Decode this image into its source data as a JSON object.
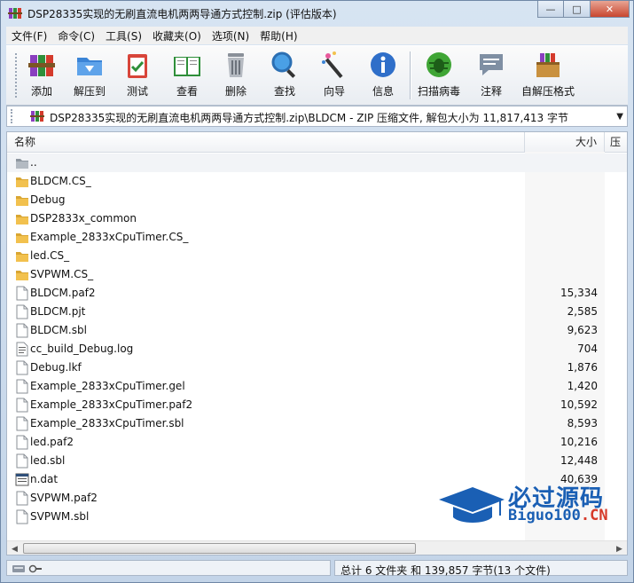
{
  "window": {
    "title": "DSP28335实现的无刷直流电机两两导通方式控制.zip (评估版本)",
    "controls": {
      "minimize": "—",
      "maximize": "□",
      "close": "✕"
    }
  },
  "menu": [
    "文件(F)",
    "命令(C)",
    "工具(S)",
    "收藏夹(O)",
    "选项(N)",
    "帮助(H)"
  ],
  "toolbar": {
    "buttons": [
      {
        "label": "添加",
        "icon": "books-icon"
      },
      {
        "label": "解压到",
        "icon": "folder-icon"
      },
      {
        "label": "测试",
        "icon": "clipboard-icon"
      },
      {
        "label": "查看",
        "icon": "book-icon"
      },
      {
        "label": "删除",
        "icon": "trash-icon"
      },
      {
        "label": "查找",
        "icon": "magnifier-icon"
      },
      {
        "label": "向导",
        "icon": "wand-icon"
      },
      {
        "label": "信息",
        "icon": "info-icon"
      },
      {
        "label": "扫描病毒",
        "icon": "bug-icon"
      },
      {
        "label": "注释",
        "icon": "comment-icon"
      },
      {
        "label": "自解压格式",
        "icon": "sfx-box-icon"
      }
    ]
  },
  "address": {
    "path": "DSP28335实现的无刷直流电机两两导通方式控制.zip\\BLDCM - ZIP 压缩文件, 解包大小为 11,817,413 字节"
  },
  "list": {
    "columns": {
      "name": "名称",
      "size": "大小",
      "packed": "压"
    },
    "rows": [
      {
        "name": "..",
        "size": "",
        "type": "parent"
      },
      {
        "name": "BLDCM.CS_",
        "size": "",
        "type": "folder"
      },
      {
        "name": "Debug",
        "size": "",
        "type": "folder"
      },
      {
        "name": "DSP2833x_common",
        "size": "",
        "type": "folder"
      },
      {
        "name": "Example_2833xCpuTimer.CS_",
        "size": "",
        "type": "folder"
      },
      {
        "name": "led.CS_",
        "size": "",
        "type": "folder"
      },
      {
        "name": "SVPWM.CS_",
        "size": "",
        "type": "folder"
      },
      {
        "name": "BLDCM.paf2",
        "size": "15,334",
        "type": "file"
      },
      {
        "name": "BLDCM.pjt",
        "size": "2,585",
        "type": "file"
      },
      {
        "name": "BLDCM.sbl",
        "size": "9,623",
        "type": "file"
      },
      {
        "name": "cc_build_Debug.log",
        "size": "704",
        "type": "log"
      },
      {
        "name": "Debug.lkf",
        "size": "1,876",
        "type": "file"
      },
      {
        "name": "Example_2833xCpuTimer.gel",
        "size": "1,420",
        "type": "file"
      },
      {
        "name": "Example_2833xCpuTimer.paf2",
        "size": "10,592",
        "type": "file"
      },
      {
        "name": "Example_2833xCpuTimer.sbl",
        "size": "8,593",
        "type": "file"
      },
      {
        "name": "led.paf2",
        "size": "10,216",
        "type": "file"
      },
      {
        "name": "led.sbl",
        "size": "12,448",
        "type": "file"
      },
      {
        "name": "n.dat",
        "size": "40,639",
        "type": "dat"
      },
      {
        "name": "SVPWM.paf2",
        "size": "",
        "type": "file"
      },
      {
        "name": "SVPWM.sbl",
        "size": "",
        "type": "file"
      }
    ]
  },
  "status": {
    "summary": "总计 6 文件夹 和 139,857 字节(13 个文件)"
  },
  "watermark": {
    "line1": "必过源码",
    "line2a": "Biguo100",
    "line2b": ".CN"
  },
  "colors": {
    "folder": "#f2c14e",
    "accent": "#1a5fb4",
    "close_button": "#c8462f"
  }
}
